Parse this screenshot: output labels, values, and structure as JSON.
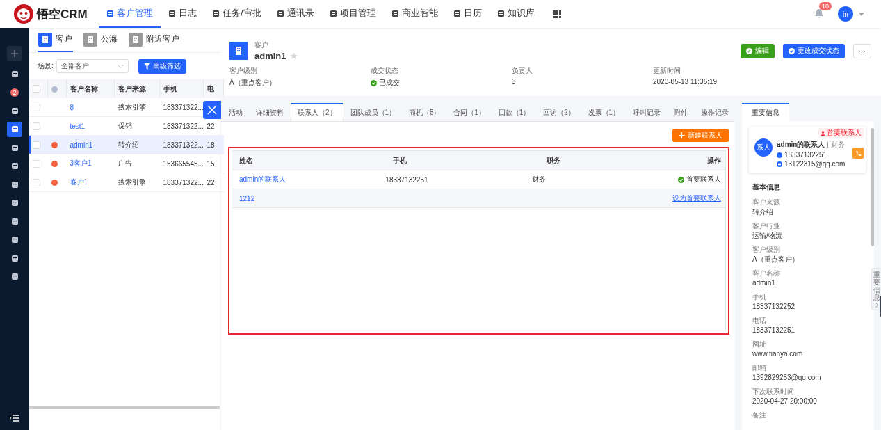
{
  "topbar": {
    "logo_text": "悟空CRM",
    "nav": [
      {
        "label": "客户管理",
        "selected": true
      },
      {
        "label": "日志",
        "selected": false
      },
      {
        "label": "任务/审批",
        "selected": false
      },
      {
        "label": "通讯录",
        "selected": false
      },
      {
        "label": "项目管理",
        "selected": false
      },
      {
        "label": "商业智能",
        "selected": false
      },
      {
        "label": "日历",
        "selected": false
      },
      {
        "label": "知识库",
        "selected": false
      }
    ],
    "notification_count": "10",
    "avatar": "in"
  },
  "sidebar": {
    "items": [
      {
        "selected": false
      },
      {
        "badge": "2",
        "selected": false
      },
      {
        "selected": false
      },
      {
        "selected": true
      },
      {
        "selected": false
      },
      {
        "selected": false
      },
      {
        "selected": false
      },
      {
        "selected": false
      },
      {
        "selected": false
      },
      {
        "selected": false
      },
      {
        "selected": false
      },
      {
        "selected": false
      }
    ]
  },
  "list_panel": {
    "tabs": [
      {
        "label": "客户",
        "selected": true
      },
      {
        "label": "公海",
        "selected": false
      },
      {
        "label": "附近客户",
        "selected": false
      }
    ],
    "select_all_checked": false,
    "scene_label": "场景:",
    "scene_value": "全部客户",
    "filter_button": "高级筛选",
    "columns": [
      "客户名称",
      "客户来源",
      "手机",
      "电"
    ],
    "rows": [
      {
        "name": "8",
        "source": "搜索引擎",
        "phone": "183371322...",
        "checked": false,
        "deal": false,
        "selected": false
      },
      {
        "name": "test1",
        "source": "促销",
        "phone": "183371322...",
        "column_4": "22",
        "checked": false,
        "deal": false,
        "selected": false
      },
      {
        "name": "admin1",
        "source": "转介绍",
        "phone": "183371322...",
        "column_4": "18",
        "checked": false,
        "deal": true,
        "selected": true
      },
      {
        "name": "3客户1",
        "source": "广告",
        "phone": "153665545...",
        "column_4": "15",
        "checked": false,
        "deal": true,
        "selected": false
      },
      {
        "name": "客户1",
        "source": "搜索引擎",
        "phone": "183371322...",
        "column_4": "22",
        "checked": false,
        "deal": true,
        "selected": false
      }
    ]
  },
  "detail": {
    "type": "客户",
    "name": "admin1",
    "starred": false,
    "fields": [
      {
        "label": "客户级别",
        "value": "A（重点客户）",
        "kind": "text"
      },
      {
        "label": "成交状态",
        "value": "已成交",
        "kind": "status"
      },
      {
        "label": "负责人",
        "value": "3",
        "kind": "text"
      },
      {
        "label": "更新时间",
        "value": "2020-05-13 11:35:19",
        "kind": "text"
      }
    ],
    "edit_button": "编辑",
    "status_button": "更改成交状态",
    "more_button": "···",
    "tabs": [
      {
        "label": "活动",
        "selected": false
      },
      {
        "label": "详细资料",
        "selected": false
      },
      {
        "label": "联系人（2）",
        "selected": true
      },
      {
        "label": "团队成员（1）",
        "selected": false
      },
      {
        "label": "商机（5）",
        "selected": false
      },
      {
        "label": "合同（1）",
        "selected": false
      },
      {
        "label": "回款（1）",
        "selected": false
      },
      {
        "label": "回访（2）",
        "selected": false
      },
      {
        "label": "发票（1）",
        "selected": false
      },
      {
        "label": "呼叫记录",
        "selected": false
      },
      {
        "label": "附件",
        "selected": false
      },
      {
        "label": "操作记录",
        "selected": false
      }
    ],
    "new_contact_button": "新建联系人",
    "contacts": {
      "columns": [
        "姓名",
        "手机",
        "职务",
        "操作"
      ],
      "rows": [
        {
          "name": "admin的联系人",
          "phone": "18337132251",
          "title": "财务",
          "action": "首要联系人",
          "primary": true,
          "hovered": false
        },
        {
          "name": "1212",
          "phone": "",
          "title": "",
          "action": "设为首要联系人",
          "primary": false,
          "hovered": true
        }
      ]
    }
  },
  "info_panel": {
    "tab": "重要信息",
    "contact": {
      "avatar": "系人",
      "name": "admin的联系人",
      "title": "财务",
      "phone": "18337132251",
      "email": "13122315@qq.com",
      "tag": "首要联系人"
    },
    "section_title": "基本信息",
    "fields": [
      {
        "label": "客户来源",
        "value": "转介绍"
      },
      {
        "label": "客户行业",
        "value": "运输/物流"
      },
      {
        "label": "客户级别",
        "value": "A（重点客户）"
      },
      {
        "label": "客户名称",
        "value": "admin1"
      },
      {
        "label": "手机",
        "value": "18337132252"
      },
      {
        "label": "电话",
        "value": "18337132251"
      },
      {
        "label": "网址",
        "value": "www.tianya.com"
      },
      {
        "label": "邮箱",
        "value": "1392829253@qq.com"
      },
      {
        "label": "下次联系时间",
        "value": "2020-04-27 20:00:00"
      },
      {
        "label": "备注"
      }
    ],
    "side_tab": "重要信息"
  }
}
